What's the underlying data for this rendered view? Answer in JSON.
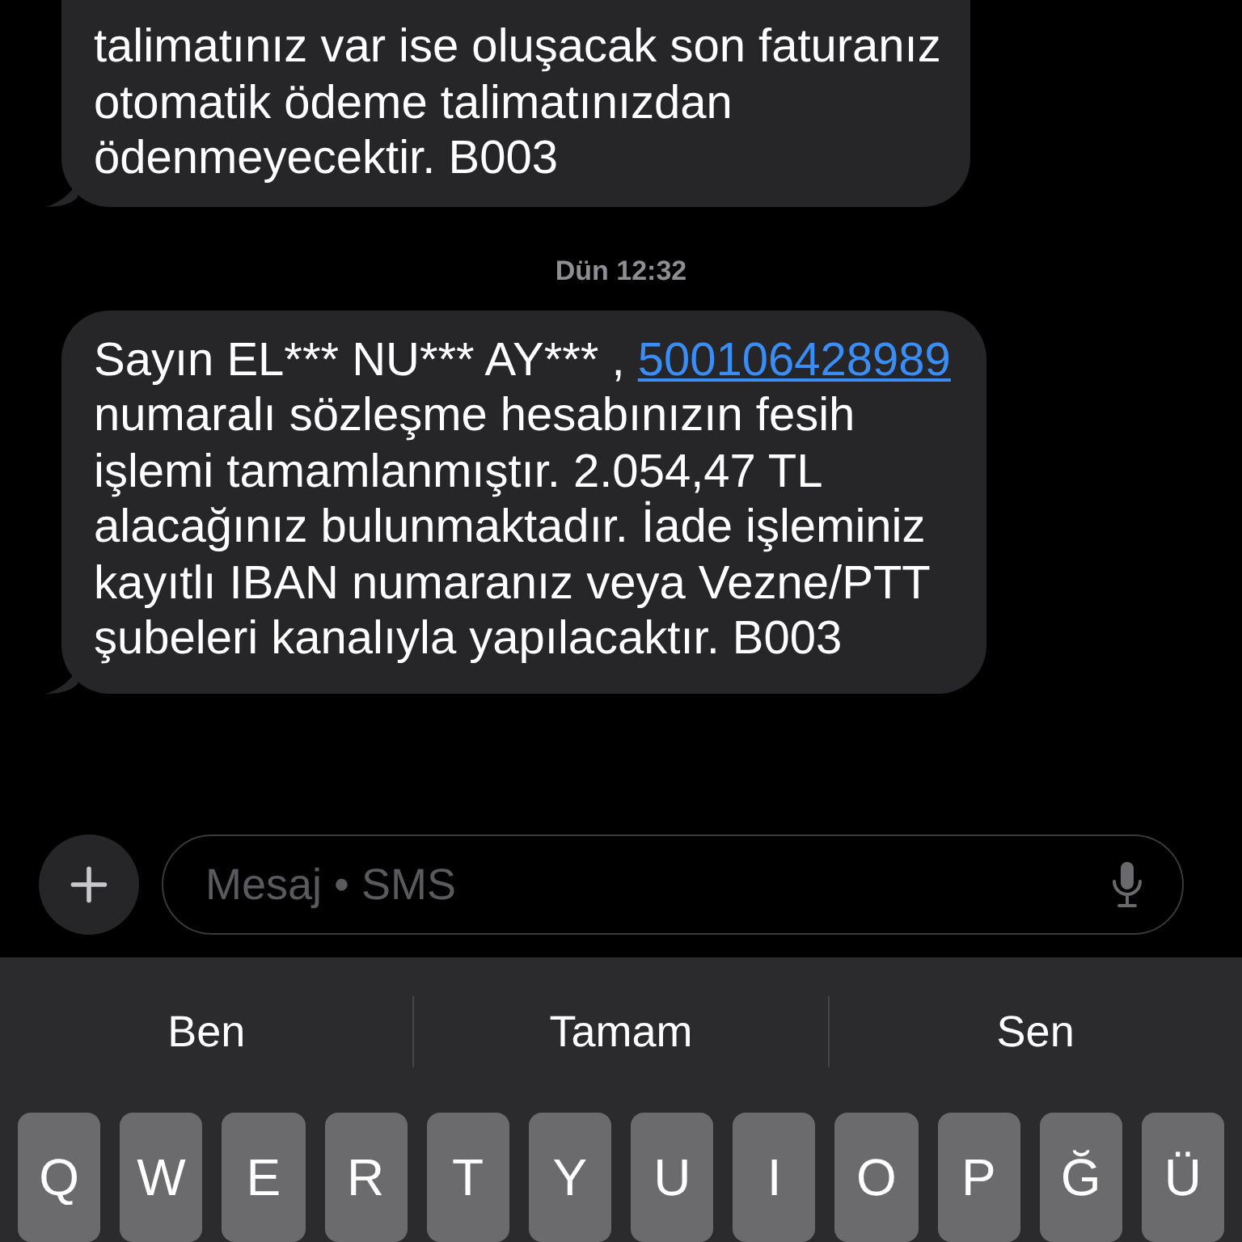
{
  "messages": [
    {
      "kind": "incoming",
      "parts": [
        {
          "kind": "text",
          "text": "talimatınız var ise oluşacak son faturanız otomatik ödeme talimatınızdan ödenmeyecektir. B003"
        }
      ]
    },
    {
      "kind": "timestamp",
      "text": "Dün 12:32"
    },
    {
      "kind": "incoming",
      "parts": [
        {
          "kind": "text",
          "text": "Sayın EL*** NU*** AY*** , "
        },
        {
          "kind": "link",
          "text": "500106428989"
        },
        {
          "kind": "text",
          "text": " numaralı sözleşme hesabınızın fesih işlemi tamamlanmıştır. 2.054,47 TL alacağınız bulunmaktadır. İade işleminiz kayıtlı IBAN numaranız veya Vezne/PTT şubeleri kanalıyla yapılacaktır. B003"
        }
      ]
    }
  ],
  "composer": {
    "placeholder": "Mesaj • SMS"
  },
  "suggestions": [
    "Ben",
    "Tamam",
    "Sen"
  ],
  "keys": [
    "Q",
    "W",
    "E",
    "R",
    "T",
    "Y",
    "U",
    "I",
    "O",
    "P",
    "Ğ",
    "Ü"
  ]
}
